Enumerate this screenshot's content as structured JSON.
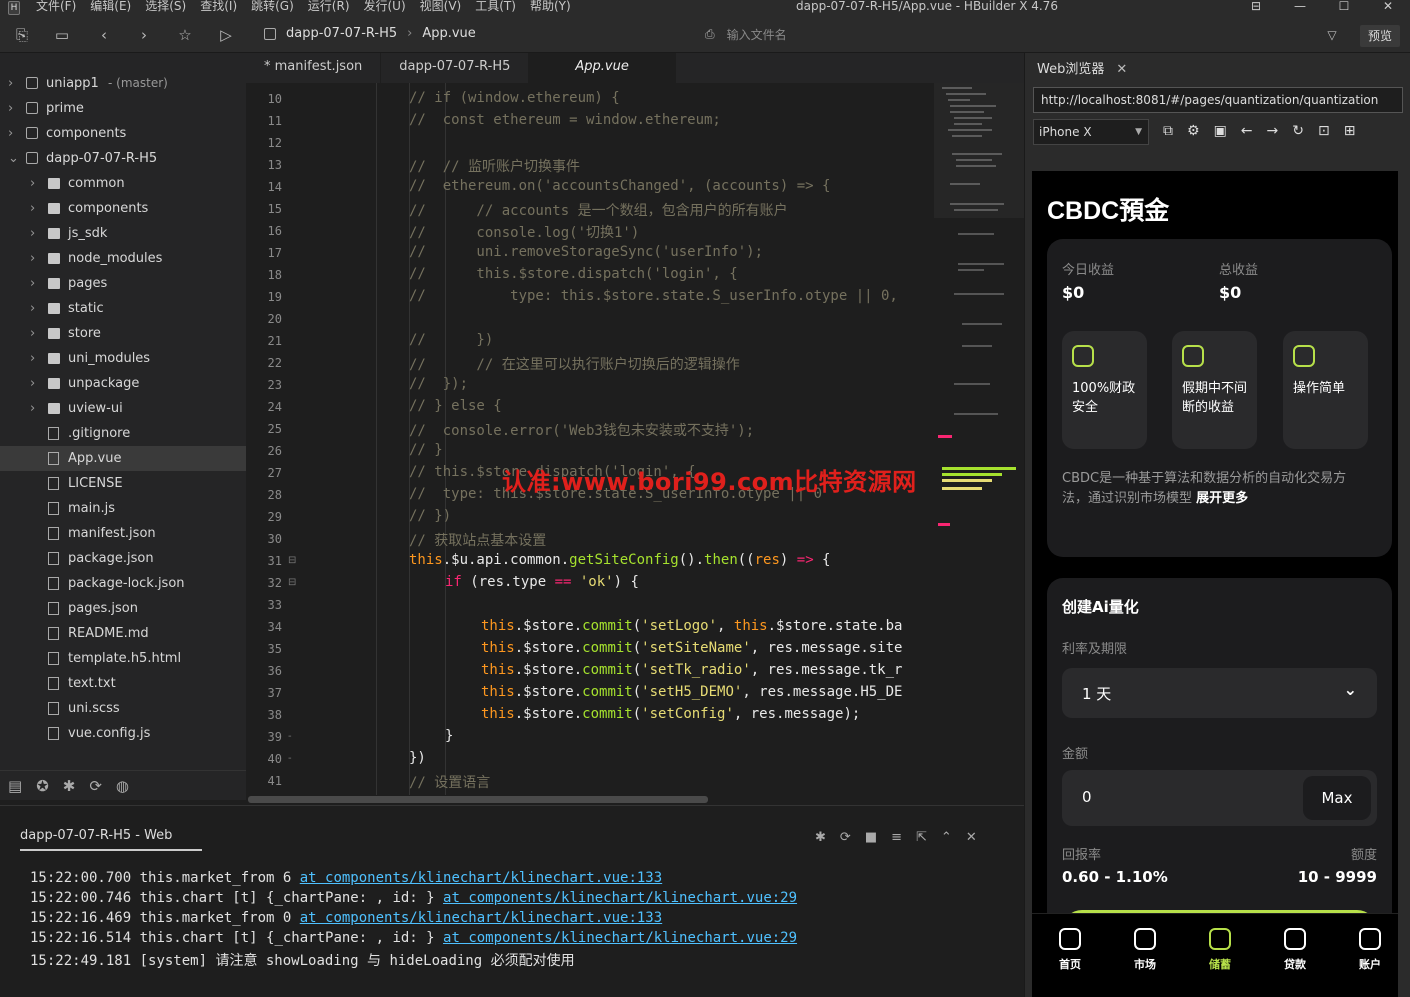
{
  "window": {
    "logo": "H",
    "title": "dapp-07-07-R-H5/App.vue - HBuilder X 4.76",
    "menu": [
      "文件(F)",
      "编辑(E)",
      "选择(S)",
      "查找(I)",
      "跳转(G)",
      "运行(R)",
      "发行(U)",
      "视图(V)",
      "工具(T)",
      "帮助(Y)"
    ],
    "controls": [
      "⊟",
      "—",
      "☐",
      "✕"
    ]
  },
  "toolbar": {
    "breadcrumb": [
      "dapp-07-07-R-H5",
      "App.vue"
    ],
    "file_input_placeholder": "输入文件名",
    "preview_label": "预览"
  },
  "sidebar": {
    "items": [
      {
        "label": "uniapp1",
        "branch": "- (master)",
        "type": "project",
        "depth": 0,
        "expanded": false
      },
      {
        "label": "prime",
        "type": "project",
        "depth": 0,
        "expanded": false
      },
      {
        "label": "components",
        "type": "project",
        "depth": 0,
        "expanded": false
      },
      {
        "label": "dapp-07-07-R-H5",
        "type": "project",
        "depth": 0,
        "expanded": true
      },
      {
        "label": "common",
        "type": "folder",
        "depth": 1
      },
      {
        "label": "components",
        "type": "folder",
        "depth": 1
      },
      {
        "label": "js_sdk",
        "type": "folder",
        "depth": 1
      },
      {
        "label": "node_modules",
        "type": "folder",
        "depth": 1
      },
      {
        "label": "pages",
        "type": "folder",
        "depth": 1
      },
      {
        "label": "static",
        "type": "folder",
        "depth": 1
      },
      {
        "label": "store",
        "type": "folder",
        "depth": 1
      },
      {
        "label": "uni_modules",
        "type": "folder",
        "depth": 1
      },
      {
        "label": "unpackage",
        "type": "folder",
        "depth": 1
      },
      {
        "label": "uview-ui",
        "type": "folder",
        "depth": 1
      },
      {
        "label": ".gitignore",
        "type": "file",
        "depth": 1
      },
      {
        "label": "App.vue",
        "type": "file",
        "depth": 1,
        "selected": true
      },
      {
        "label": "LICENSE",
        "type": "file",
        "depth": 1
      },
      {
        "label": "main.js",
        "type": "file",
        "depth": 1
      },
      {
        "label": "manifest.json",
        "type": "file",
        "depth": 1
      },
      {
        "label": "package.json",
        "type": "file",
        "depth": 1
      },
      {
        "label": "package-lock.json",
        "type": "file",
        "depth": 1
      },
      {
        "label": "pages.json",
        "type": "file",
        "depth": 1
      },
      {
        "label": "README.md",
        "type": "file",
        "depth": 1
      },
      {
        "label": "template.h5.html",
        "type": "file",
        "depth": 1
      },
      {
        "label": "text.txt",
        "type": "file",
        "depth": 1
      },
      {
        "label": "uni.scss",
        "type": "file",
        "depth": 1
      },
      {
        "label": "vue.config.js",
        "type": "file",
        "depth": 1
      }
    ]
  },
  "tabs": [
    {
      "label": "* manifest.json",
      "active": false
    },
    {
      "label": "dapp-07-07-R-H5",
      "active": false
    },
    {
      "label": "App.vue",
      "active": true
    }
  ],
  "editor": {
    "lines": [
      {
        "n": "10",
        "indent": 0,
        "tokens": [
          [
            "c-com",
            "// if (window.ethereum) {"
          ]
        ]
      },
      {
        "n": "11",
        "indent": 0,
        "tokens": [
          [
            "c-com",
            "//  const ethereum = window.ethereum;"
          ]
        ]
      },
      {
        "n": "12",
        "indent": 0,
        "tokens": []
      },
      {
        "n": "13",
        "indent": 0,
        "tokens": [
          [
            "c-com",
            "//  // 监听账户切换事件"
          ]
        ]
      },
      {
        "n": "14",
        "indent": 0,
        "tokens": [
          [
            "c-com",
            "//  ethereum.on('accountsChanged', (accounts) => {"
          ]
        ]
      },
      {
        "n": "15",
        "indent": 0,
        "tokens": [
          [
            "c-com",
            "//      // accounts 是一个数组，包含用户的所有账户"
          ]
        ]
      },
      {
        "n": "16",
        "indent": 0,
        "tokens": [
          [
            "c-com",
            "//      console.log('切换1')"
          ]
        ]
      },
      {
        "n": "17",
        "indent": 0,
        "tokens": [
          [
            "c-com",
            "//      uni.removeStorageSync('userInfo');"
          ]
        ]
      },
      {
        "n": "18",
        "indent": 0,
        "tokens": [
          [
            "c-com",
            "//      this.$store.dispatch('login', {"
          ]
        ]
      },
      {
        "n": "19",
        "indent": 0,
        "tokens": [
          [
            "c-com",
            "//          type: this.$store.state.S_userInfo.otype || 0,"
          ]
        ]
      },
      {
        "n": "20",
        "indent": 0,
        "tokens": []
      },
      {
        "n": "21",
        "indent": 0,
        "tokens": [
          [
            "c-com",
            "//      })"
          ]
        ]
      },
      {
        "n": "22",
        "indent": 0,
        "tokens": [
          [
            "c-com",
            "//      // 在这里可以执行账户切换后的逻辑操作"
          ]
        ]
      },
      {
        "n": "23",
        "indent": 0,
        "tokens": [
          [
            "c-com",
            "//  });"
          ]
        ]
      },
      {
        "n": "24",
        "indent": 0,
        "tokens": [
          [
            "c-com",
            "// } else {"
          ]
        ]
      },
      {
        "n": "25",
        "indent": 0,
        "tokens": [
          [
            "c-com",
            "//  console.error('Web3钱包未安装或不支持');"
          ]
        ]
      },
      {
        "n": "26",
        "indent": 0,
        "tokens": [
          [
            "c-com",
            "// }"
          ]
        ]
      },
      {
        "n": "27",
        "indent": 0,
        "tokens": [
          [
            "c-com",
            "// this.$store.dispatch('login', {"
          ]
        ]
      },
      {
        "n": "28",
        "indent": 0,
        "tokens": [
          [
            "c-com",
            "//  type: this.$store.state.S_userInfo.otype || 0"
          ]
        ]
      },
      {
        "n": "29",
        "indent": 0,
        "tokens": [
          [
            "c-com",
            "// })"
          ]
        ]
      },
      {
        "n": "30",
        "indent": 0,
        "tokens": [
          [
            "c-com",
            "// 获取站点基本设置"
          ]
        ]
      },
      {
        "n": "31",
        "indent": 0,
        "fold": "⊟",
        "tokens": [
          [
            "c-th",
            "this"
          ],
          [
            "c-plain",
            ".$u.api.common."
          ],
          [
            "c-fn",
            "getSiteConfig"
          ],
          [
            "c-plain",
            "()."
          ],
          [
            "c-fn",
            "then"
          ],
          [
            "c-plain",
            "(("
          ],
          [
            "c-th",
            "res"
          ],
          [
            "c-plain",
            ") "
          ],
          [
            "c-kw",
            "=>"
          ],
          [
            "c-plain",
            " {"
          ]
        ]
      },
      {
        "n": "32",
        "indent": 1,
        "fold": "⊟",
        "tokens": [
          [
            "c-kw",
            "if"
          ],
          [
            "c-plain",
            " (res.type "
          ],
          [
            "c-kw",
            "=="
          ],
          [
            "c-plain",
            " "
          ],
          [
            "c-str",
            "'ok'"
          ],
          [
            "c-plain",
            ") {"
          ]
        ]
      },
      {
        "n": "33",
        "indent": 0,
        "tokens": []
      },
      {
        "n": "34",
        "indent": 2,
        "tokens": [
          [
            "c-th",
            "this"
          ],
          [
            "c-plain",
            ".$store."
          ],
          [
            "c-fn",
            "commit"
          ],
          [
            "c-plain",
            "("
          ],
          [
            "c-str",
            "'setLogo'"
          ],
          [
            "c-plain",
            ", "
          ],
          [
            "c-th",
            "this"
          ],
          [
            "c-plain",
            ".$store.state.ba"
          ]
        ]
      },
      {
        "n": "35",
        "indent": 2,
        "tokens": [
          [
            "c-th",
            "this"
          ],
          [
            "c-plain",
            ".$store."
          ],
          [
            "c-fn",
            "commit"
          ],
          [
            "c-plain",
            "("
          ],
          [
            "c-str",
            "'setSiteName'"
          ],
          [
            "c-plain",
            ", res.message.site"
          ]
        ]
      },
      {
        "n": "36",
        "indent": 2,
        "tokens": [
          [
            "c-th",
            "this"
          ],
          [
            "c-plain",
            ".$store."
          ],
          [
            "c-fn",
            "commit"
          ],
          [
            "c-plain",
            "("
          ],
          [
            "c-str",
            "'setTk_radio'"
          ],
          [
            "c-plain",
            ", res.message.tk_r"
          ]
        ]
      },
      {
        "n": "37",
        "indent": 2,
        "tokens": [
          [
            "c-th",
            "this"
          ],
          [
            "c-plain",
            ".$store."
          ],
          [
            "c-fn",
            "commit"
          ],
          [
            "c-plain",
            "("
          ],
          [
            "c-str",
            "'setH5_DEMO'"
          ],
          [
            "c-plain",
            ", res.message.H5_DE"
          ]
        ]
      },
      {
        "n": "38",
        "indent": 2,
        "tokens": [
          [
            "c-th",
            "this"
          ],
          [
            "c-plain",
            ".$store."
          ],
          [
            "c-fn",
            "commit"
          ],
          [
            "c-plain",
            "("
          ],
          [
            "c-str",
            "'setConfig'"
          ],
          [
            "c-plain",
            ", res.message);"
          ]
        ]
      },
      {
        "n": "39",
        "indent": 1,
        "fold": "-",
        "tokens": [
          [
            "c-plain",
            "}"
          ]
        ]
      },
      {
        "n": "40",
        "indent": 0,
        "fold": "-",
        "tokens": [
          [
            "c-plain",
            "})"
          ]
        ]
      },
      {
        "n": "41",
        "indent": 0,
        "tokens": [
          [
            "c-com",
            "// 设置语言"
          ]
        ]
      }
    ],
    "watermark": "认准:www.bori99.com比特资源网"
  },
  "console": {
    "tab_label": "dapp-07-07-R-H5 - Web",
    "icons": [
      "bug-icon",
      "reload-icon",
      "stop-icon",
      "filter-icon",
      "export-icon",
      "collapse-icon",
      "close-icon"
    ],
    "lines": [
      {
        "time": "15:22:00.700",
        "text": " this.market_from 6 ",
        "link": "at components/klinechart/klinechart.vue:133"
      },
      {
        "time": "15:22:00.746",
        "text": " this.chart [t] {_chartPane: , id: } ",
        "link": "at components/klinechart/klinechart.vue:29"
      },
      {
        "time": "15:22:16.469",
        "text": " this.market_from 0 ",
        "link": "at components/klinechart/klinechart.vue:133"
      },
      {
        "time": "15:22:16.514",
        "text": " this.chart [t] {_chartPane: , id: } ",
        "link": "at components/klinechart/klinechart.vue:29"
      },
      {
        "time": "15:22:49.181",
        "text": " [system] 请注意 showLoading 与 hideLoading 必须配对使用",
        "link": ""
      }
    ]
  },
  "browser": {
    "tab_label": "Web浏览器",
    "url": "http://localhost:8081/#/pages/quantization/quantization",
    "device": "iPhone X",
    "app": {
      "title": "CBDC預金",
      "today_label": "今日收益",
      "today_value": "$0",
      "total_label": "总收益",
      "total_value": "$0",
      "features": [
        "100%财政安全",
        "假期中不间断的收益",
        "操作简单"
      ],
      "desc": "CBDC是一种基于算法和数据分析的自动化交易方法，通过识别市场模型",
      "desc_more": "展开更多",
      "create_title": "创建Ai量化",
      "rate_label": "利率及期限",
      "rate_value": "1 天",
      "amount_label": "金额",
      "amount_value": "0",
      "max_label": "Max",
      "return_label": "回报率",
      "return_value": "0.60 - 1.10%",
      "limit_label": "额度",
      "limit_value": "10 - 9999",
      "nav": [
        {
          "label": "首页",
          "active": false
        },
        {
          "label": "市场",
          "active": false
        },
        {
          "label": "储蓄",
          "active": true
        },
        {
          "label": "贷款",
          "active": false
        },
        {
          "label": "账户",
          "active": false
        }
      ]
    }
  },
  "colors": {
    "accent": "#b7e04a",
    "watermark": "#e0201c",
    "link": "#4fc1ff"
  }
}
